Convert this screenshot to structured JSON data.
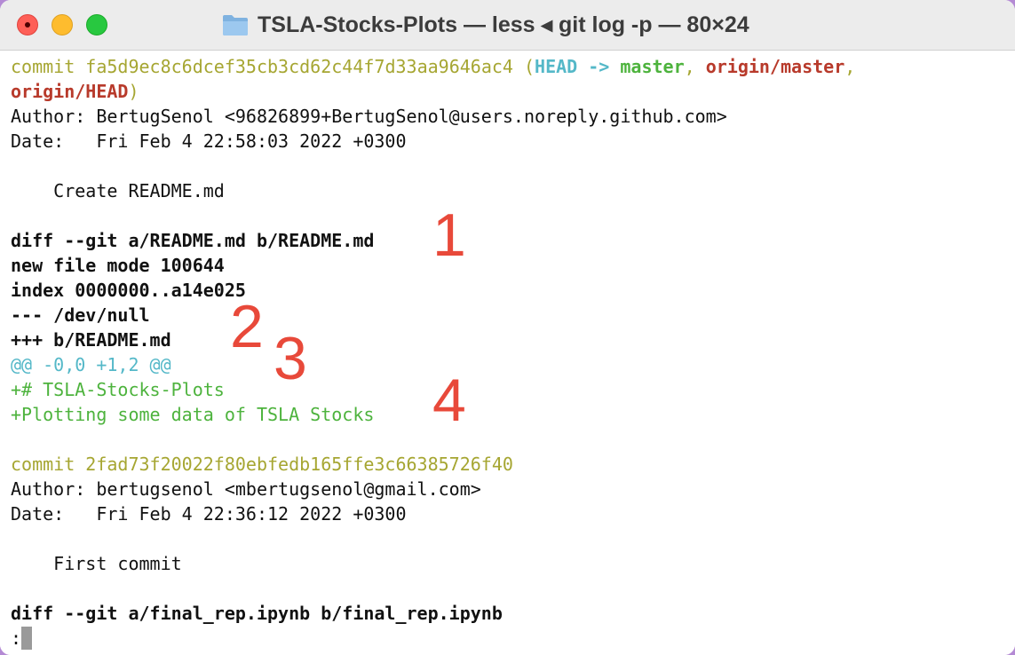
{
  "window": {
    "title": "TSLA-Stocks-Plots — less ◂ git log -p — 80×24",
    "folder_icon": "folder-icon",
    "colors": {
      "commit_hash": "#a6a632",
      "head_ref": "#54b8c8",
      "branch": "#4db33d",
      "remote": "#b83a2b",
      "annotation": "#e8493a"
    }
  },
  "terminal": {
    "commit1": {
      "label": "commit",
      "hash": "fa5d9ec8c6dcef35cb3cd62c44f7d33aa9646ac4",
      "paren_open": "(",
      "head": "HEAD ->",
      "master": "master",
      "comma1": ",",
      "origin_master": "origin/master",
      "comma2": ",",
      "origin_head": "origin/HEAD",
      "paren_close": ")",
      "author": "Author: BertugSenol <96826899+BertugSenol@users.noreply.github.com>",
      "date": "Date:   Fri Feb 4 22:58:03 2022 +0300",
      "message": "    Create README.md",
      "diff_header": "diff --git a/README.md b/README.md",
      "new_file": "new file mode 100644",
      "index": "index 0000000..a14e025",
      "minus": "--- /dev/null",
      "plus": "+++ b/README.md",
      "hunk": "@@ -0,0 +1,2 @@",
      "add1": "+# TSLA-Stocks-Plots",
      "add2": "+Plotting some data of TSLA Stocks"
    },
    "commit2": {
      "line": "commit 2fad73f20022f80ebfedb165ffe3c66385726f40",
      "author": "Author: bertugsenol <mbertugsenol@gmail.com>",
      "date": "Date:   Fri Feb 4 22:36:12 2022 +0300",
      "message": "    First commit",
      "diff_header": "diff --git a/final_rep.ipynb b/final_rep.ipynb"
    },
    "prompt": ":"
  },
  "annotations": [
    "1",
    "2",
    "3",
    "4"
  ]
}
